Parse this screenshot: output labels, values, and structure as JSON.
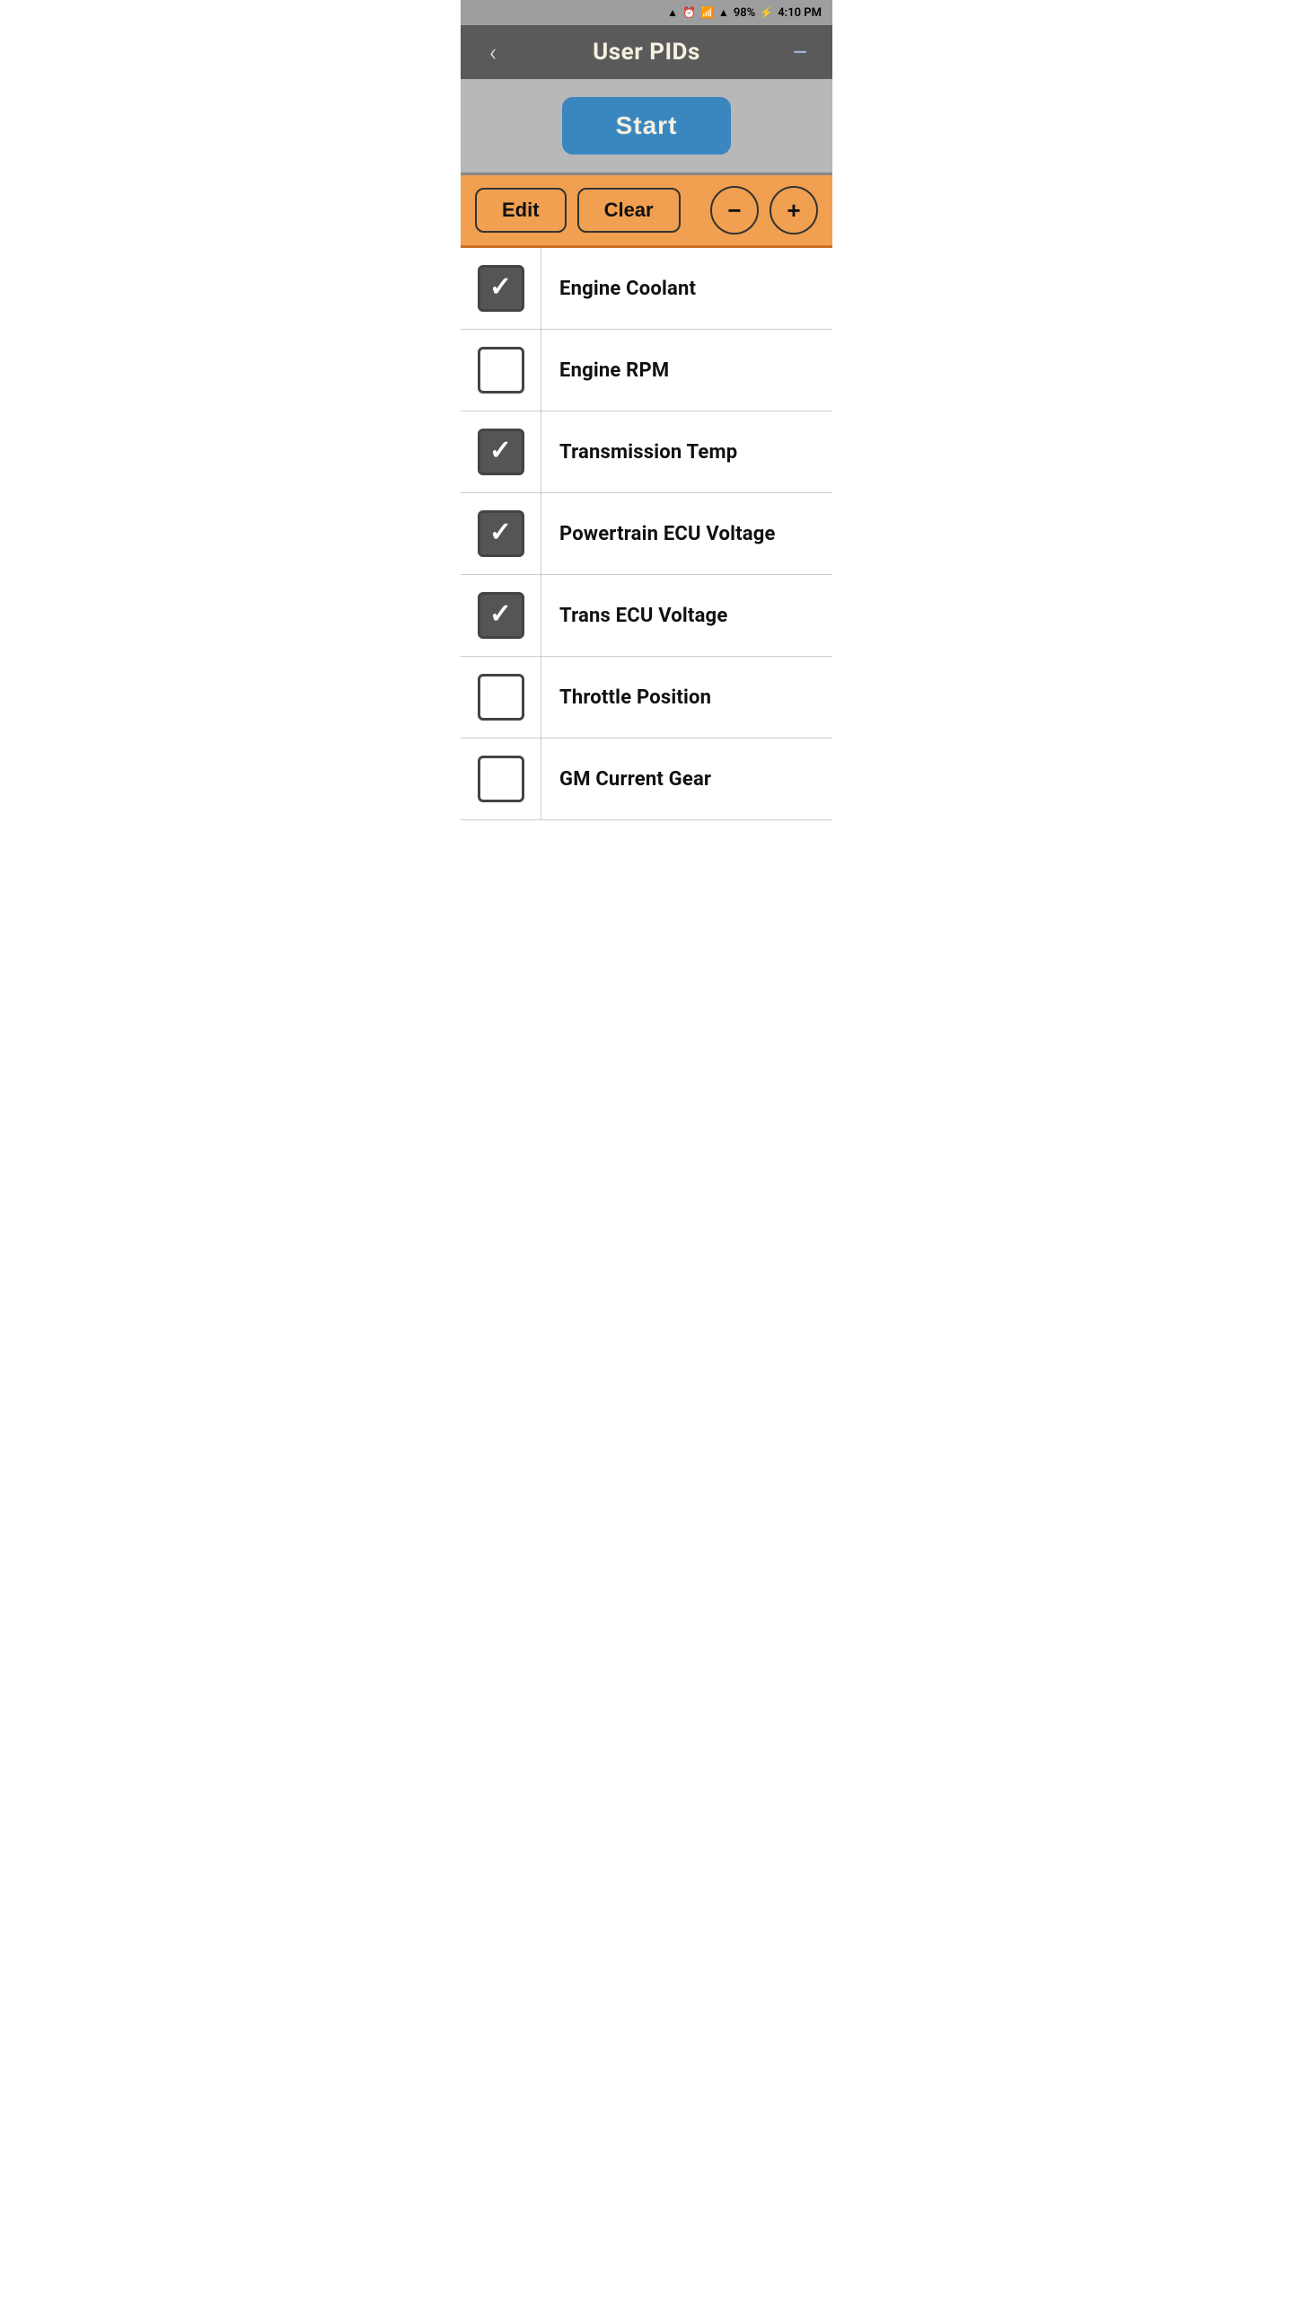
{
  "status_bar": {
    "battery": "98%",
    "time": "4:10 PM"
  },
  "nav": {
    "back_label": "‹",
    "title": "User PIDs",
    "menu_label": "—"
  },
  "start_button": {
    "label": "Start"
  },
  "toolbar": {
    "edit_label": "Edit",
    "clear_label": "Clear",
    "minus_label": "−",
    "plus_label": "+"
  },
  "pid_items": [
    {
      "id": 1,
      "label": "Engine Coolant",
      "checked": true
    },
    {
      "id": 2,
      "label": "Engine RPM",
      "checked": false
    },
    {
      "id": 3,
      "label": "Transmission Temp",
      "checked": true
    },
    {
      "id": 4,
      "label": "Powertrain ECU Voltage",
      "checked": true
    },
    {
      "id": 5,
      "label": "Trans ECU Voltage",
      "checked": true
    },
    {
      "id": 6,
      "label": "Throttle Position",
      "checked": false
    },
    {
      "id": 7,
      "label": "GM Current Gear",
      "checked": false
    }
  ],
  "colors": {
    "nav_bg": "#5a5a5a",
    "toolbar_bg": "#f0a050",
    "start_bg": "#3a87c0",
    "checked_bg": "#555555"
  }
}
